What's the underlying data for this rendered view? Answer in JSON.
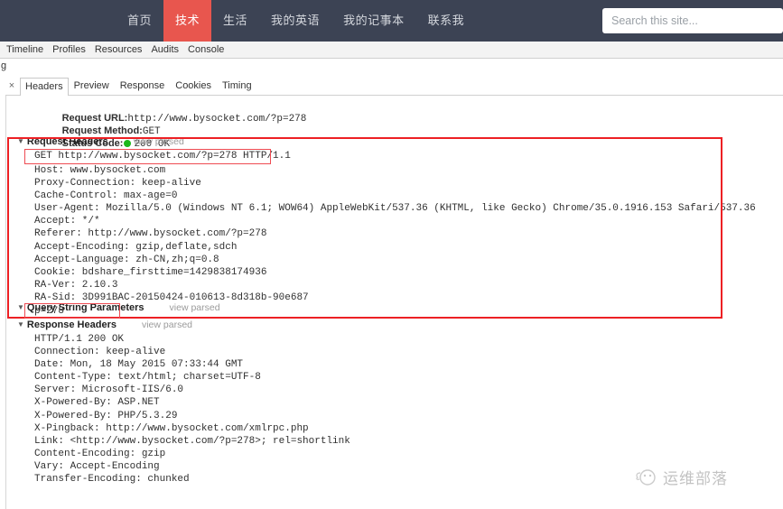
{
  "site_nav": {
    "items": [
      {
        "label": "首页",
        "active": false
      },
      {
        "label": "技术",
        "active": true
      },
      {
        "label": "生活",
        "active": false
      },
      {
        "label": "我的英语",
        "active": false
      },
      {
        "label": "我的记事本",
        "active": false
      },
      {
        "label": "联系我",
        "active": false
      }
    ],
    "search_placeholder": "Search this site...",
    "search_value": "",
    "bg_color": "#3c4354",
    "active_color": "#e8564e"
  },
  "devtools_toolbar": {
    "items": [
      "Timeline",
      "Profiles",
      "Resources",
      "Audits",
      "Console"
    ]
  },
  "stray_text": "g",
  "subtabs": {
    "close_label": "×",
    "items": [
      {
        "label": "Headers",
        "active": true
      },
      {
        "label": "Preview",
        "active": false
      },
      {
        "label": "Response",
        "active": false
      },
      {
        "label": "Cookies",
        "active": false
      },
      {
        "label": "Timing",
        "active": false
      }
    ]
  },
  "summary": {
    "request_url_label": "Request URL:",
    "request_url_value": "http://www.bysocket.com/?p=278",
    "request_method_label": "Request Method:",
    "request_method_value": "GET",
    "status_code_label": "Status Code:",
    "status_code_value": "200 OK",
    "status_dot_color": "#1bb81b"
  },
  "request_headers": {
    "title": "Request Headers",
    "view_parsed": "view parsed",
    "triangle": "▼",
    "request_line": "GET http://www.bysocket.com/?p=278 HTTP/1.1",
    "lines": [
      "Host: www.bysocket.com",
      "Proxy-Connection: keep-alive",
      "Cache-Control: max-age=0",
      "User-Agent: Mozilla/5.0 (Windows NT 6.1; WOW64) AppleWebKit/537.36 (KHTML, like Gecko) Chrome/35.0.1916.153 Safari/537.36",
      "Accept: */*",
      "Referer: http://www.bysocket.com/?p=278",
      "Accept-Encoding: gzip,deflate,sdch",
      "Accept-Language: zh-CN,zh;q=0.8",
      "Cookie: bdshare_firsttime=1429838174936",
      "RA-Ver: 2.10.3",
      "RA-Sid: 3D991BAC-20150424-010613-8d318b-90e687"
    ]
  },
  "query_string_parameters": {
    "title": "Query String Parameters",
    "view_parsed": "view parsed",
    "triangle": "▼",
    "lines": [
      "p=278"
    ]
  },
  "response_headers": {
    "title": "Response Headers",
    "view_parsed": "view parsed",
    "triangle": "▼",
    "lines": [
      "HTTP/1.1 200 OK",
      "Connection: keep-alive",
      "Date: Mon, 18 May 2015 07:33:44 GMT",
      "Content-Type: text/html; charset=UTF-8",
      "Server: Microsoft-IIS/6.0",
      "X-Powered-By: ASP.NET",
      "X-Powered-By: PHP/5.3.29",
      "X-Pingback: http://www.bysocket.com/xmlrpc.php",
      "Link: <http://www.bysocket.com/?p=278>; rel=shortlink",
      "Content-Encoding: gzip",
      "Vary: Accept-Encoding",
      "Transfer-Encoding: chunked"
    ]
  },
  "annotations": {
    "color": "#ed2024"
  },
  "watermark": {
    "text": "运维部落"
  }
}
